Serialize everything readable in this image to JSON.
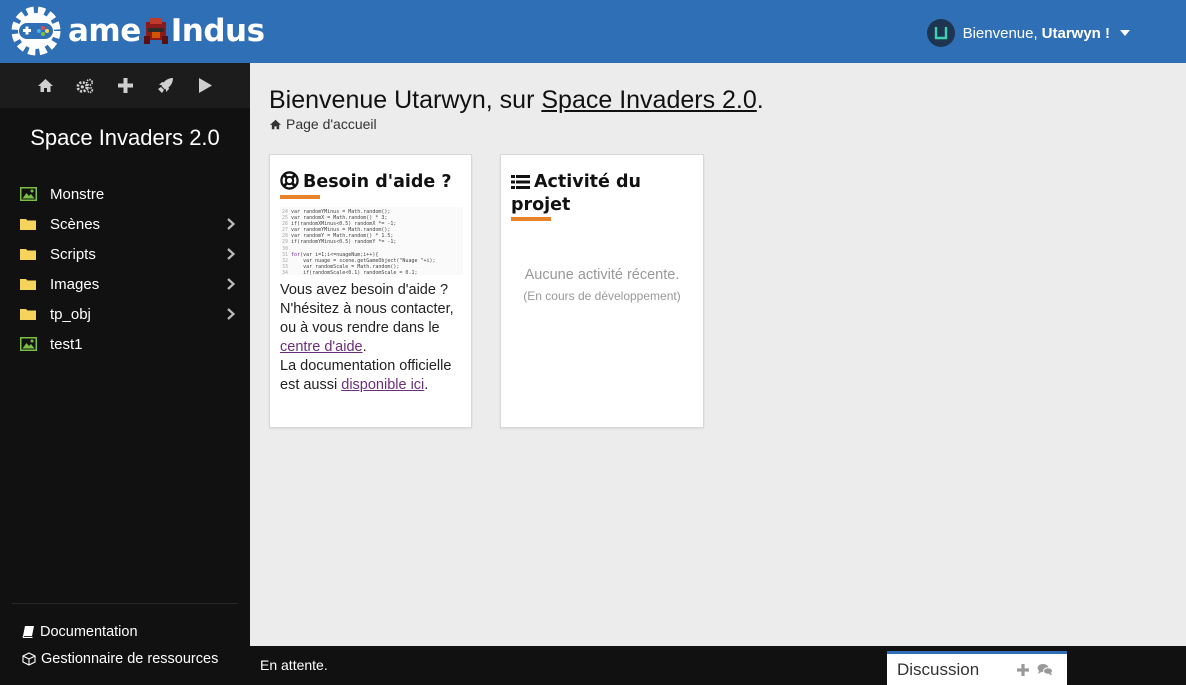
{
  "header": {
    "logo_text_a": "ame",
    "logo_text_b": "Indus",
    "greeting": "Bienvenue,",
    "username": "Utarwyn !",
    "avatar_initial": "U"
  },
  "sidebar": {
    "toolbar": [
      "home-icon",
      "gears-icon",
      "plus-icon",
      "rocket-icon",
      "play-icon"
    ],
    "project_title": "Space Invaders 2.0",
    "items": [
      {
        "label": "Monstre",
        "icon": "image-icon",
        "expandable": false
      },
      {
        "label": "Scènes",
        "icon": "folder-icon",
        "expandable": true
      },
      {
        "label": "Scripts",
        "icon": "folder-icon",
        "expandable": true
      },
      {
        "label": "Images",
        "icon": "folder-icon",
        "expandable": true
      },
      {
        "label": "tp_obj",
        "icon": "folder-icon",
        "expandable": true
      },
      {
        "label": "test1",
        "icon": "image-icon",
        "expandable": false
      }
    ],
    "documentation_label": "Documentation",
    "resources_label": "Gestionnaire de ressources"
  },
  "main": {
    "title_prefix": "Bienvenue Utarwyn, sur ",
    "title_project": "Space Invaders 2.0",
    "title_suffix": ".",
    "breadcrumb": "Page d'accueil",
    "help_card": {
      "title": "Besoin d'aide ?",
      "text_1": "Vous avez besoin d'aide ? N'hésitez à nous contacter, ou à vous rendre dans le ",
      "link_1": "centre d'aide",
      "text_2": ".",
      "text_3": "La documentation officielle est aussi ",
      "link_2": "disponible ici",
      "text_4": "."
    },
    "activity_card": {
      "title": "Activité du projet",
      "empty": "Aucune activité récente.",
      "note": "(En cours de développement)"
    }
  },
  "status": {
    "text": "En attente.",
    "discussion_label": "Discussion"
  },
  "colors": {
    "header": "#2f6fb5",
    "sidebar": "#111111",
    "accent": "#e8832b",
    "image_icon": "#7bc043",
    "folder_icon": "#f6d35b",
    "link": "#6a2f7a"
  }
}
